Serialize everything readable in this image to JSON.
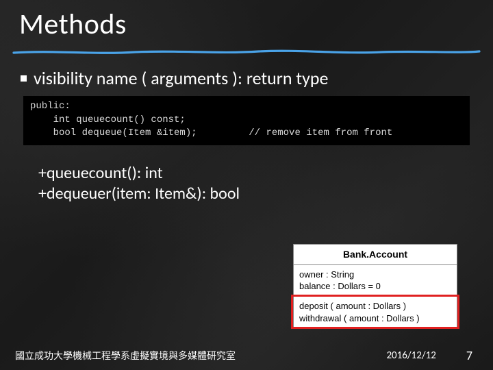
{
  "title": "Methods",
  "bullet": "visibility name ( arguments ): return type",
  "code": {
    "l1": "public:",
    "l2": "    int queuecount() const;",
    "l3": "    bool dequeue(Item &item);         // remove item from front"
  },
  "uml_example": {
    "l1": "+queuecount(): int",
    "l2": "+dequeuer(item: Item&): bool"
  },
  "uml_table": {
    "class_name": "Bank.Account",
    "attributes": {
      "a1": "owner : String",
      "a2": "balance : Dollars = 0"
    },
    "methods": {
      "m1": "deposit ( amount : Dollars )",
      "m2": "withdrawal ( amount : Dollars )"
    }
  },
  "footer": {
    "org": "國立成功大學機械工程學系虛擬實境與多媒體研究室",
    "date": "2016/12/12",
    "page": "7"
  }
}
